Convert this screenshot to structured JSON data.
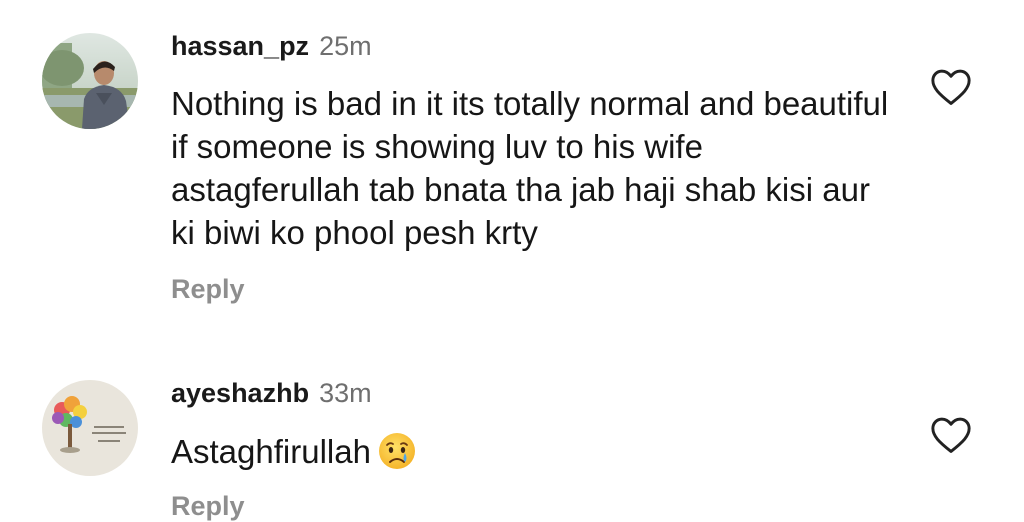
{
  "comments": [
    {
      "username": "hassan_pz",
      "time": "25m",
      "text": "Nothing is bad in it its totally  normal and beautiful if someone is showing luv to his wife astagferullah tab bnata tha jab haji shab kisi aur ki biwi ko phool pesh krty",
      "reply_label": "Reply",
      "avatar_icon": "user-photo-avatar",
      "like_icon": "heart-outline-icon"
    },
    {
      "username": "ayeshazhb",
      "time": "33m",
      "text": "Astaghfirullah",
      "emoji": "crying-face-emoji",
      "reply_label": "Reply",
      "avatar_icon": "illustrated-tree-avatar",
      "like_icon": "heart-outline-icon"
    }
  ],
  "colors": {
    "username": "#1a1a1a",
    "timestamp": "#6f6f6f",
    "reply": "#8e8e8e",
    "text": "#161616",
    "heart_stroke": "#222222"
  }
}
